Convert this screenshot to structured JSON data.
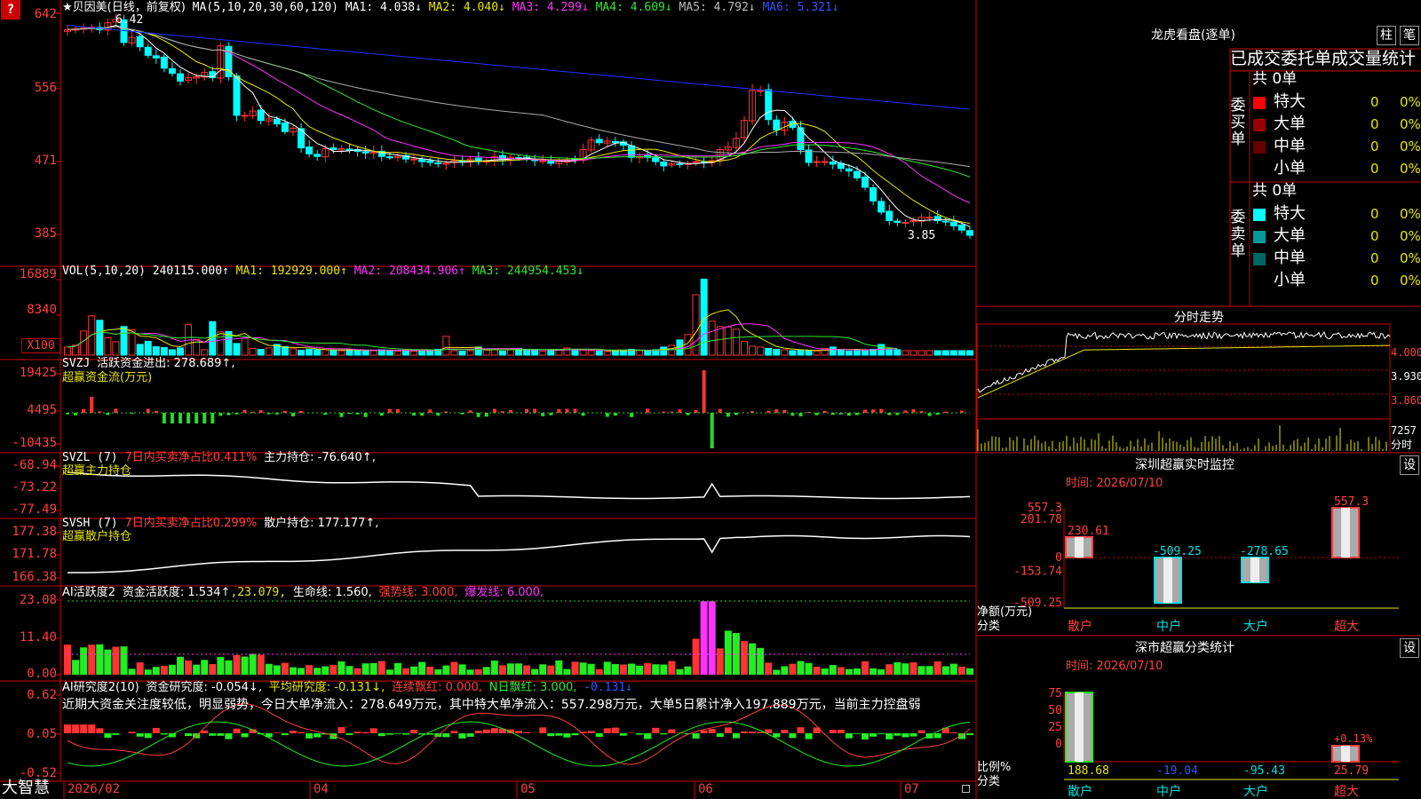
{
  "brand": "大智慧",
  "colors": {
    "up": "#ff3333",
    "down": "#00ffff",
    "ma1": "#ffffff",
    "ma2": "#e8e800",
    "ma3": "#ff33ff",
    "ma4": "#33e833",
    "ma5": "#aaaaaa",
    "ma6": "#2233ff",
    "grid": "#cc0000"
  },
  "header": {
    "title": "★贝因美(日线，前复权)",
    "ma_params": "MA(5,10,20,30,60,120)",
    "ma1": "MA1: 4.038↓",
    "ma2": "MA2: 4.040↓",
    "ma3": "MA3: 4.299↓",
    "ma4": "MA4: 4.609↓",
    "ma5": "MA5: 4.792↓",
    "ma6": "MA6: 5.321↓",
    "question": "?",
    "peak": "6.42",
    "last": "3.85"
  },
  "vol": {
    "label": "VOL(5,10,20)",
    "val": "240115.000↑",
    "ma1": "MA1: 192929.000↑",
    "ma2": "MA2: 208434.906↑",
    "ma3": "MA3: 244954.453↓",
    "unit": "X100"
  },
  "svzj": {
    "label": "SVZJ",
    "sub": "活跃资金进出: 278.689↑,",
    "sub2": "超赢资金流(万元)"
  },
  "svzl": {
    "label": "SVZL (7)",
    "pct": "7日内买卖净占比0.411%",
    "pos": "主力持仓: -76.640↑,",
    "sub2": "超赢主力持仓"
  },
  "svsh": {
    "label": "SVSH (7)",
    "pct": "7日内买卖净占比0.299%",
    "pos": "散户持仓: 177.177↑,",
    "sub2": "超赢散户持仓"
  },
  "ai1": {
    "label": "AI活跃度2",
    "v1": "资金活跃度: 1.534↑",
    "v2": ",23.079,",
    "v3": "生命线: 1.560,",
    "v4": "强势线: 3.000,",
    "v5": "爆发线: 6.000,"
  },
  "ai2": {
    "label": "AI研究度2(10)",
    "v1": "资金研究度: -0.054↓,",
    "v2": "平均研究度: -0.131↓,",
    "v3": "连续飘红: 0.000,",
    "v4": "N日飘红: 3.000,",
    "v5": "-0.131↓",
    "comment": "近期大资金关注度较低，明显弱势，今日大单净流入：278.649万元，其中特大单净流入：557.298万元，大单5日累计净入197.889万元，当前主力控盘弱"
  },
  "yaxis": {
    "price": [
      "642",
      "556",
      "471",
      "385"
    ],
    "vol": [
      "16889",
      "8340"
    ],
    "svzj": [
      "19425",
      "4495",
      "-10435"
    ],
    "svzl": [
      "-68.94",
      "-73.22",
      "-77.49"
    ],
    "svsh": [
      "177.38",
      "171.78",
      "166.38"
    ],
    "ai1": [
      "23.08",
      "11.40",
      "0.00"
    ],
    "ai2": [
      "0.62",
      "0.05",
      "-0.52"
    ]
  },
  "xaxis": [
    "2026/02",
    "04",
    "05",
    "06",
    "07"
  ],
  "right": {
    "lhb": {
      "title": "龙虎看盘(逐单)",
      "btn1": "柱",
      "btn2": "笔",
      "subtitle": "已成交委托单成交量统计",
      "buy": {
        "label": "委买单",
        "total": "共 0单",
        "rows": [
          {
            "name": "特大",
            "n": "0",
            "pct": "0%",
            "color": "#ff0000"
          },
          {
            "name": "大单",
            "n": "0",
            "pct": "0%",
            "color": "#990000"
          },
          {
            "name": "中单",
            "n": "0",
            "pct": "0%",
            "color": "#660000"
          },
          {
            "name": "小单",
            "n": "0",
            "pct": "0%",
            "color": "#000000"
          }
        ]
      },
      "sell": {
        "label": "委卖单",
        "total": "共 0单",
        "rows": [
          {
            "name": "特大",
            "n": "0",
            "pct": "0%",
            "color": "#00ffff"
          },
          {
            "name": "大单",
            "n": "0",
            "pct": "0%",
            "color": "#009999"
          },
          {
            "name": "中单",
            "n": "0",
            "pct": "0%",
            "color": "#006666"
          },
          {
            "name": "小单",
            "n": "0",
            "pct": "0%",
            "color": "#000000"
          }
        ]
      }
    },
    "intraday": {
      "title": "分时走势",
      "p1": "4.000",
      "p2": "3.930",
      "p3": "3.860",
      "vol": "7257",
      "vol_label": "分时"
    },
    "sz_monitor": {
      "title": "深圳超赢实时监控",
      "btn": "设",
      "time": "时间: 2026/07/10",
      "yticks": [
        "557.3",
        "201.78",
        "0",
        "-153.74",
        "-509.25"
      ],
      "ylabel": "净额(万元)",
      "xlabel": "分类"
    },
    "sz_stats": {
      "title": "深市超赢分类统计",
      "btn": "设",
      "time": "时间: 2026/07/10",
      "yticks": [
        "75",
        "50",
        "25",
        "0"
      ],
      "ylabel": "比例%",
      "xlabel": "分类"
    }
  },
  "chart_data": [
    {
      "type": "candlestick",
      "title": "贝因美 日线",
      "ylim": [
        3.85,
        6.42
      ],
      "yticks": [
        6.42,
        5.56,
        4.71,
        3.85
      ],
      "x": [
        "2026/02",
        "04",
        "05",
        "06",
        "07"
      ],
      "close": [
        6.25,
        6.26,
        6.27,
        6.28,
        6.25,
        6.33,
        6.37,
        6.1,
        6.16,
        6.05,
        5.95,
        5.92,
        5.8,
        5.74,
        5.65,
        5.69,
        5.7,
        5.75,
        5.69,
        6.06,
        5.7,
        5.25,
        5.25,
        5.3,
        5.19,
        5.21,
        5.15,
        5.06,
        5.1,
        4.87,
        4.8,
        4.77,
        4.86,
        4.85,
        4.86,
        4.84,
        4.83,
        4.81,
        4.82,
        4.77,
        4.76,
        4.77,
        4.74,
        4.74,
        4.71,
        4.7,
        4.69,
        4.69,
        4.72,
        4.71,
        4.74,
        4.71,
        4.72,
        4.77,
        4.73,
        4.76,
        4.75,
        4.74,
        4.72,
        4.72,
        4.69,
        4.71,
        4.73,
        4.73,
        4.85,
        4.96,
        4.93,
        4.95,
        4.93,
        4.9,
        4.76,
        4.77,
        4.76,
        4.71,
        4.66,
        4.69,
        4.68,
        4.69,
        4.71,
        4.7,
        4.72,
        4.85,
        4.88,
        4.98,
        5.19,
        5.54,
        5.54,
        5.2,
        5.08,
        5.17,
        5.11,
        4.85,
        4.7,
        4.71,
        4.71,
        4.68,
        4.63,
        4.6,
        4.52,
        4.41,
        4.25,
        4.12,
        4.02,
        4.0,
        4.0,
        4.02,
        4.06,
        4.06,
        4.02,
        4.01,
        3.96,
        3.91,
        3.85
      ],
      "ma": {
        "MA1": 4.038,
        "MA2": 4.04,
        "MA3": 4.299,
        "MA4": 4.609,
        "MA5": 4.792,
        "MA6": 5.321
      }
    },
    {
      "type": "bar",
      "title": "VOL",
      "ylim": [
        0,
        16889
      ],
      "yticks": [
        16889,
        8340
      ],
      "series": [
        {
          "name": "VOL",
          "values": [
            1800,
            2200,
            5400,
            8800,
            7800,
            3900,
            3000,
            6400,
            5700,
            2400,
            3100,
            1900,
            1700,
            1200,
            1600,
            6800,
            3500,
            1200,
            7500,
            5200,
            5300,
            2600,
            3800,
            1500,
            1300,
            1600,
            2400,
            1900,
            1400,
            1100,
            1300,
            1200,
            1200,
            1100,
            1000,
            1300,
            1000,
            1100,
            1000,
            1200,
            1100,
            900,
            1000,
            900,
            1000,
            1100,
            1300,
            4200,
            1000,
            900,
            1000,
            1800,
            1100,
            1300,
            900,
            1200,
            1500,
            1300,
            1000,
            900,
            1100,
            1200,
            1600,
            1300,
            1100,
            1000,
            900,
            800,
            1000,
            1100,
            1300,
            1100,
            900,
            1200,
            1800,
            2200,
            3400,
            4600,
            13500,
            17000,
            7600,
            6400,
            6300,
            5800,
            3100,
            2000,
            1800,
            1500,
            1300,
            1200,
            1000,
            1100,
            1000,
            900,
            1500,
            1800,
            1200,
            900,
            1100,
            1100,
            1300,
            2400,
            1400,
            1200
          ]
        }
      ]
    },
    {
      "type": "bar",
      "title": "SVZJ",
      "ylim": [
        -10435,
        19425
      ],
      "yticks": [
        19425,
        4495,
        -10435
      ]
    },
    {
      "type": "line",
      "title": "SVZL",
      "ylim": [
        -77.49,
        -68.94
      ],
      "yticks": [
        -68.94,
        -73.22,
        -77.49
      ]
    },
    {
      "type": "line",
      "title": "SVSH",
      "ylim": [
        166.38,
        177.38
      ],
      "yticks": [
        177.38,
        171.78,
        166.38
      ]
    },
    {
      "type": "bar",
      "title": "AI活跃度2",
      "ylim": [
        0,
        23.08
      ],
      "yticks": [
        23.08,
        11.4,
        0.0
      ]
    },
    {
      "type": "bar",
      "title": "AI研究度2(10)",
      "ylim": [
        -0.52,
        0.62
      ],
      "yticks": [
        0.62,
        0.05,
        -0.52
      ]
    },
    {
      "type": "bar",
      "title": "深圳超赢实时监控",
      "categories": [
        "散户",
        "中户",
        "大户",
        "超大"
      ],
      "values": [
        230.61,
        -509.25,
        -278.65,
        557.3
      ],
      "ylim": [
        -509.25,
        557.3
      ]
    },
    {
      "type": "bar",
      "title": "深市超赢分类统计",
      "categories": [
        "散户",
        "中户",
        "大户",
        "超大"
      ],
      "values": [
        188.68,
        -19.04,
        -95.43,
        25.79
      ],
      "annotation": "+0.13%"
    }
  ]
}
